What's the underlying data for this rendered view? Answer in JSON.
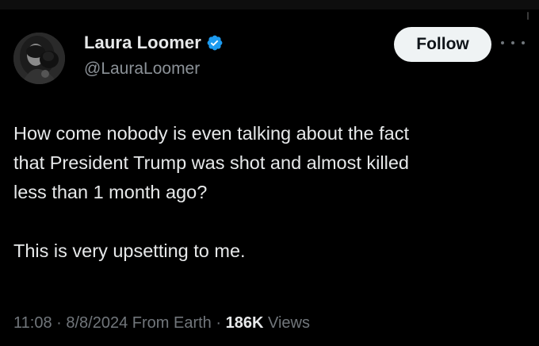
{
  "author": {
    "display_name": "Laura Loomer",
    "handle": "@LauraLoomer",
    "verified": true,
    "verified_color": "#1d9bf0"
  },
  "actions": {
    "follow_label": "Follow",
    "more_icon": "more-horizontal-icon"
  },
  "tweet": {
    "lines": [
      "How come nobody is even talking about the fact",
      "that President Trump was shot and almost killed",
      "less than 1 month ago?",
      "This is very upsetting to me."
    ]
  },
  "meta": {
    "time": "11:08",
    "separator_1": " · ",
    "date": "8/8/2024",
    "source": "From Earth",
    "separator_2": " · ",
    "views_count": "186K",
    "views_label": "Views"
  },
  "colors": {
    "background": "#000000",
    "text_primary": "#e7e9ea",
    "text_secondary": "#71767b",
    "follow_bg": "#eff3f4",
    "follow_text": "#0f1419"
  }
}
